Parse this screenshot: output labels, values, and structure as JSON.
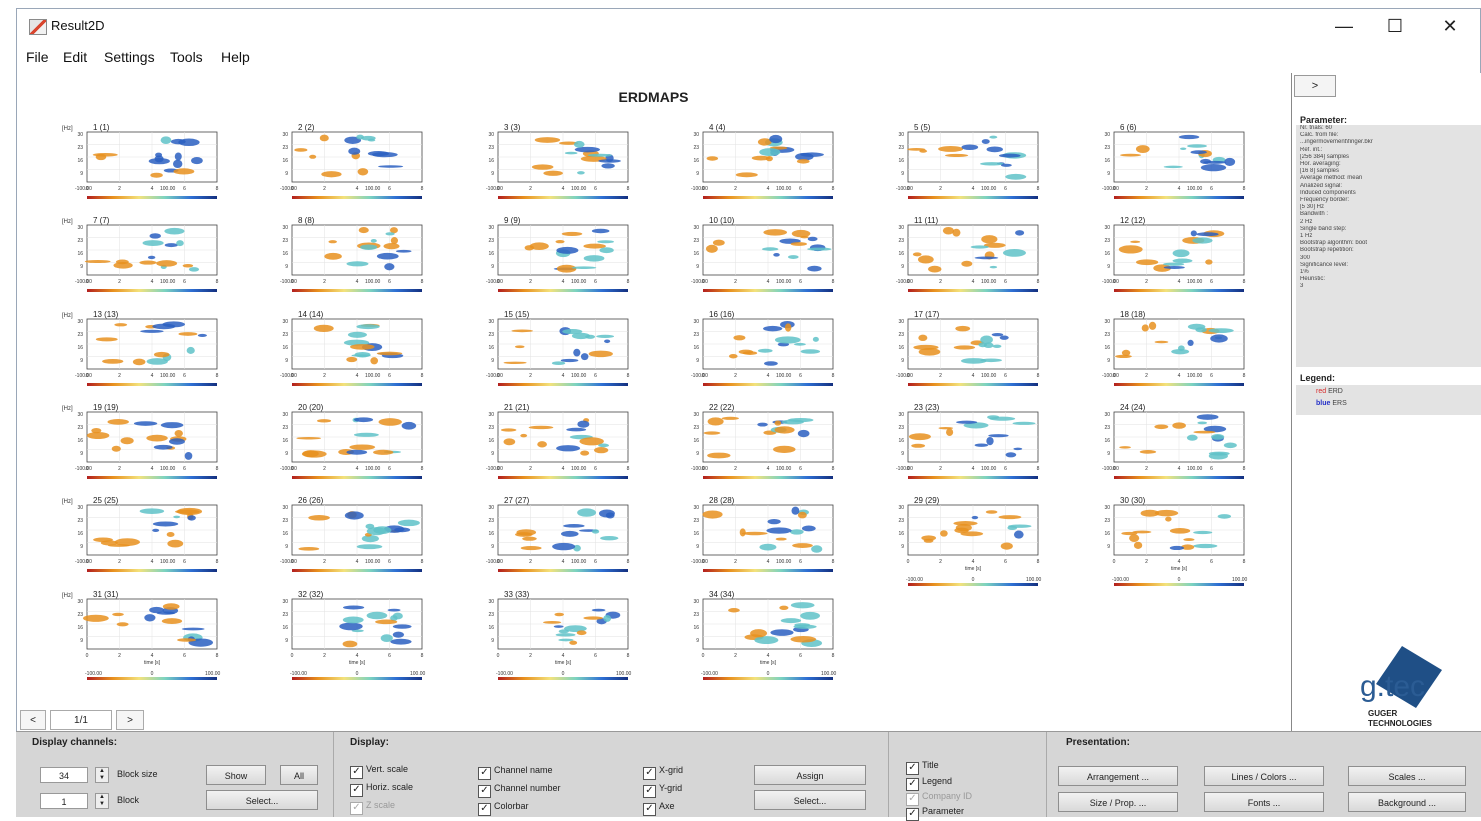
{
  "window": {
    "title": "Result2D",
    "controls": [
      "—",
      "☐",
      "✕"
    ]
  },
  "menu": [
    "File",
    "Edit",
    "Settings",
    "Tools",
    "Help"
  ],
  "figure": {
    "title": "ERDMAPS",
    "unit_label": "[Hz]",
    "y_ticks": [
      "30",
      "23",
      "16",
      "9"
    ],
    "x_ticks": [
      "0",
      "2",
      "4",
      "6",
      "8"
    ],
    "time_label": "time [s]",
    "cbar_min": "-100.00",
    "cbar_mid": "0",
    "cbar_max": "100.00",
    "colorbar_colors": [
      "#b21f1f",
      "#e8901e",
      "#f3e27c",
      "#7cd3c0",
      "#2e6fd4",
      "#14307f"
    ],
    "channels": [
      "1 (1)",
      "2 (2)",
      "3 (3)",
      "4 (4)",
      "5 (5)",
      "6 (6)",
      "7 (7)",
      "8 (8)",
      "9 (9)",
      "10 (10)",
      "11 (11)",
      "12 (12)",
      "13 (13)",
      "14 (14)",
      "15 (15)",
      "16 (16)",
      "17 (17)",
      "18 (18)",
      "19 (19)",
      "20 (20)",
      "21 (21)",
      "22 (22)",
      "23 (23)",
      "24 (24)",
      "25 (25)",
      "26 (26)",
      "27 (27)",
      "28 (28)",
      "29 (29)",
      "30 (30)",
      "31 (31)",
      "32 (32)",
      "33 (33)",
      "34 (34)"
    ],
    "erd_color": "#e8901e",
    "ers_color": "#2a5fc1",
    "ers_light_color": "#5fc2c8"
  },
  "panel": {
    "toggle": ">",
    "parameter_title": "Parameter:",
    "parameters": [
      "Nr. trials: 60",
      "Calc. from file:",
      "...ingermovement\\finger.bkr",
      "Ref. int.:",
      "[256 384] samples",
      "Hor. averaging:",
      "[16 8] samples",
      "Average method: mean",
      "Analized signal:",
      "Induced components",
      "Frequency border:",
      "[5 30] Hz",
      "Bandwith :",
      "2 Hz",
      "Single band step:",
      "1 Hz",
      "Bootstrap algorithm: boot",
      "Bootstrap repetition:",
      "300",
      "Significance level:",
      "1%",
      "Heuristic:",
      "3"
    ],
    "legend_title": "Legend:",
    "legend": [
      {
        "key": "red",
        "label": "ERD",
        "color": "#d62b2b"
      },
      {
        "key": "blue",
        "label": "ERS",
        "color": "#2430c8"
      }
    ],
    "logo_text": "g.tec",
    "logo_sub1": "GUGER",
    "logo_sub2": "TECHNOLOGIES"
  },
  "pager": {
    "prev": "<",
    "page": "1/1",
    "next": ">"
  },
  "bottom": {
    "display_channels_title": "Display channels:",
    "block_size_value": "34",
    "block_size_label": "Block size",
    "block_value": "1",
    "block_label": "Block",
    "show": "Show",
    "all": "All",
    "select": "Select...",
    "display_title": "Display:",
    "checks_col1": [
      {
        "label": "Vert. scale",
        "checked": true,
        "enabled": true
      },
      {
        "label": "Horiz. scale",
        "checked": true,
        "enabled": true
      },
      {
        "label": "Z scale",
        "checked": true,
        "enabled": false
      }
    ],
    "checks_col2": [
      {
        "label": "Channel name",
        "checked": true
      },
      {
        "label": "Channel number",
        "checked": true
      },
      {
        "label": "Colorbar",
        "checked": true
      }
    ],
    "checks_col3": [
      {
        "label": "X-grid",
        "checked": true
      },
      {
        "label": "Y-grid",
        "checked": true
      },
      {
        "label": "Axe",
        "checked": true
      }
    ],
    "assign": "Assign",
    "select2": "Select...",
    "checks_col4": [
      {
        "label": "Title",
        "checked": true,
        "enabled": true
      },
      {
        "label": "Legend",
        "checked": true,
        "enabled": true
      },
      {
        "label": "Company ID",
        "checked": true,
        "enabled": false
      },
      {
        "label": "Parameter",
        "checked": true,
        "enabled": true
      }
    ],
    "presentation_title": "Presentation:",
    "arrangement": "Arrangement ...",
    "lines_colors": "Lines / Colors ...",
    "scales": "Scales ...",
    "size_prop": "Size / Prop. ...",
    "fonts": "Fonts ...",
    "background": "Background ..."
  }
}
